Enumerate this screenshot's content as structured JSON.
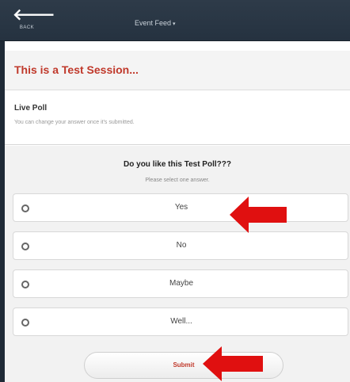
{
  "header": {
    "back_label": "BACK",
    "feed_title": "Event Feed",
    "feed_caret": "▾"
  },
  "session": {
    "title": "This is a Test Session..."
  },
  "poll": {
    "type_label": "Live Poll",
    "note": "You can change your answer once it's submitted.",
    "question": "Do you like this Test Poll???",
    "instruction": "Please select one answer.",
    "options": [
      "Yes",
      "No",
      "Maybe",
      "Well..."
    ],
    "submit_label": "Submit"
  },
  "colors": {
    "accent_red": "#c0392b",
    "annotation_arrow": "#e01010"
  }
}
